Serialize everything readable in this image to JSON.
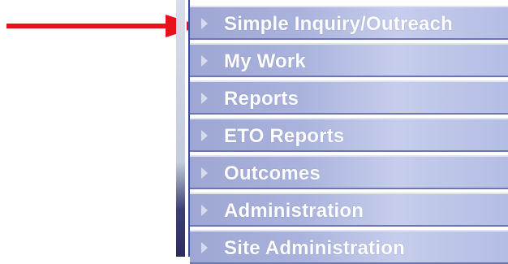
{
  "annotation": {
    "arrow_color": "#e8111a",
    "arrow_icon": "right-arrow"
  },
  "menu": {
    "accent": "#a9b2dd",
    "items": [
      {
        "label": "Simple Inquiry/Outreach",
        "icon": "chevron-right-icon"
      },
      {
        "label": "My Work",
        "icon": "chevron-right-icon"
      },
      {
        "label": "Reports",
        "icon": "chevron-right-icon"
      },
      {
        "label": "ETO Reports",
        "icon": "chevron-right-icon"
      },
      {
        "label": "Outcomes",
        "icon": "chevron-right-icon"
      },
      {
        "label": "Administration",
        "icon": "chevron-right-icon"
      },
      {
        "label": "Site Administration",
        "icon": "chevron-right-icon"
      }
    ]
  }
}
